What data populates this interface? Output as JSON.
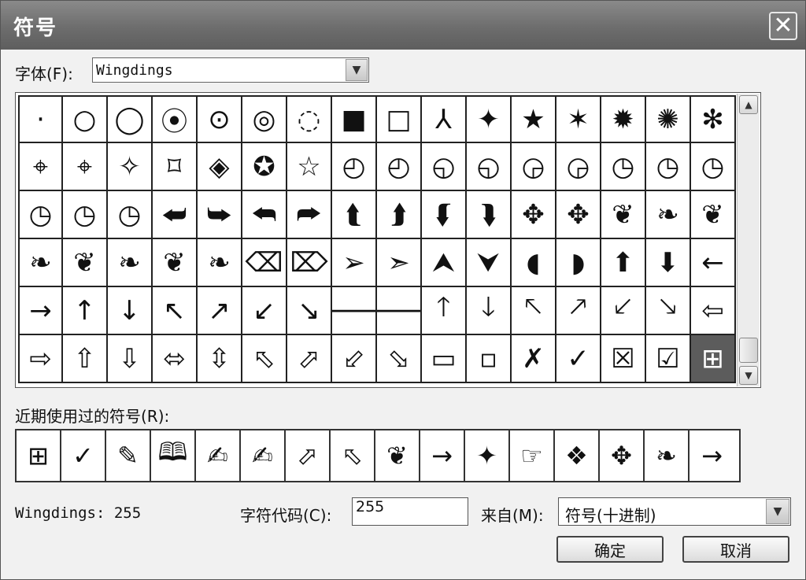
{
  "window": {
    "title": "符号",
    "close_glyph": "✕"
  },
  "font": {
    "label": "字体(F):",
    "value": "Wingdings"
  },
  "symbols": [
    [
      "·",
      "○",
      "◯",
      "⦿",
      "⊙",
      "◎",
      "◌",
      "■",
      "□",
      "⅄",
      "✦",
      "★",
      "✶",
      "✹",
      "✺",
      "✻"
    ],
    [
      "⌖",
      "⌖",
      "✧",
      "⌑",
      "◈",
      "✪",
      "☆",
      "◴",
      "◴",
      "◵",
      "◵",
      "◶",
      "◶",
      "◷",
      "◷",
      "◷"
    ],
    [
      "◷",
      "◷",
      "◷",
      "⮨",
      "⮩",
      "⮪",
      "⮫",
      "⮬",
      "⮭",
      "⮮",
      "⮯",
      "✥",
      "✥",
      "❦",
      "❧",
      "❦"
    ],
    [
      "❧",
      "❦",
      "❧",
      "❦",
      "❧",
      "⌫",
      "⌦",
      "➢",
      "➣",
      "⮝",
      "⮟",
      "◖",
      "◗",
      "⬆",
      "⬇",
      "←"
    ],
    [
      "→",
      "↑",
      "↓",
      "↖",
      "↗",
      "↙",
      "↘",
      "🡐",
      "🡒",
      "🡑",
      "🡓",
      "🡔",
      "🡕",
      "🡗",
      "🡖",
      "⇦"
    ],
    [
      "⇨",
      "⇧",
      "⇩",
      "⬄",
      "⇳",
      "⬁",
      "⬀",
      "⬃",
      "⬂",
      "▭",
      "▫",
      "✗",
      "✓",
      "☒",
      "☑",
      "⊞"
    ]
  ],
  "selected": {
    "row": 5,
    "col": 15
  },
  "scrollbar": {
    "up_glyph": "▲",
    "down_glyph": "▼"
  },
  "recent": {
    "label": "近期使用过的符号(R):",
    "items": [
      "⊞",
      "✓",
      "✎",
      "🕮",
      "✍",
      "✍",
      "⬀",
      "⬁",
      "❦",
      "→",
      "✦",
      "☞",
      "❖",
      "✥",
      "❧",
      "→"
    ]
  },
  "info": {
    "text": "Wingdings: 255"
  },
  "char_code": {
    "label": "字符代码(C):",
    "value": "255"
  },
  "from": {
    "label": "来自(M):",
    "value": "符号(十进制)",
    "arrow_glyph": "▼"
  },
  "buttons": {
    "ok": "确定",
    "cancel": "取消"
  }
}
